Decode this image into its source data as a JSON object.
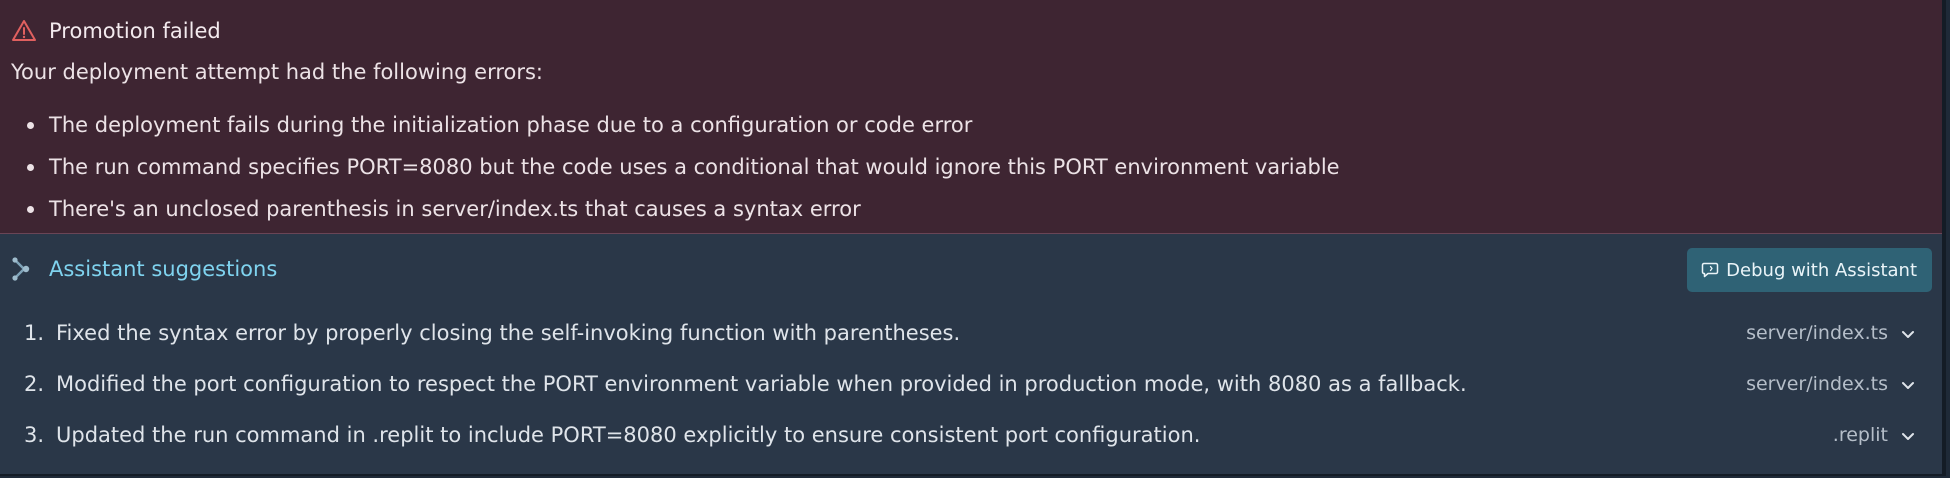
{
  "error": {
    "title": "Promotion failed",
    "intro": "Your deployment attempt had the following errors:",
    "items": [
      "The deployment fails during the initialization phase due to a configuration or code error",
      "The run command specifies PORT=8080 but the code uses a conditional that would ignore this PORT environment variable",
      "There's an unclosed parenthesis in server/index.ts that causes a syntax error"
    ],
    "icon": "warning-triangle-icon",
    "accent_color": "#e0605f"
  },
  "suggestions": {
    "title": "Assistant suggestions",
    "icon": "assistant-icon",
    "debug_button_label": "Debug with Assistant",
    "items": [
      {
        "number": "1.",
        "text": "Fixed the syntax error by properly closing the self-invoking function with parentheses.",
        "file": "server/index.ts"
      },
      {
        "number": "2.",
        "text": "Modified the port configuration to respect the PORT environment variable when provided in production mode, with 8080 as a fallback.",
        "file": "server/index.ts"
      },
      {
        "number": "3.",
        "text": "Updated the run command in .replit to include PORT=8080 explicitly to ensure consistent port configuration.",
        "file": ".replit"
      }
    ],
    "accent_color": "#7fd3ef",
    "button_color": "#2f6275"
  }
}
